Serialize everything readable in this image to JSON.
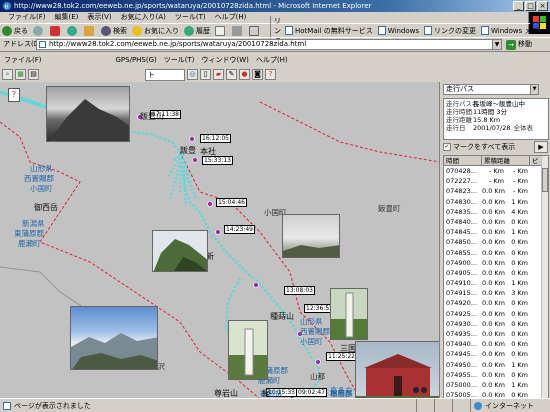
{
  "browser": {
    "title": "http://www28.tok2.com/eeweb.ne.jp/sports/wataruya/20010728zida.html - Microsoft Internet Explorer",
    "menu": [
      "ファイル(F)",
      "編集(E)",
      "表示(V)",
      "お気に入り(A)",
      "ツール(T)",
      "ヘルプ(H)"
    ],
    "toolbar": {
      "back": "戻る",
      "search": "検索",
      "favorites": "お気に入り",
      "history": "履歴",
      "links_label": "リンク"
    },
    "links": [
      "HotMail の無料サービス",
      "Windows",
      "リンクの変更",
      "Windows メディア"
    ],
    "address_label": "アドレス(D)",
    "address": "http://www28.tok2.com/eeweb.ne.jp/sports/wataruya/20010728zida.html",
    "go_label": "移動",
    "status": "ページが表示されました",
    "zone": "インターネット"
  },
  "app": {
    "menu": [
      "ファイル(F)",
      "GPS/PHS(G)",
      "ツール(T)",
      "ウィンドウ(W)",
      "ヘルプ(H)"
    ],
    "select_value": "ト"
  },
  "map": {
    "places": [
      {
        "text": "飯豊山",
        "style": "black"
      },
      {
        "text": "飯豊",
        "style": "black"
      },
      {
        "text": "本社",
        "style": "black"
      },
      {
        "text": "山形県",
        "style": "blue"
      },
      {
        "text": "西置賜郡",
        "style": "blue"
      },
      {
        "text": "小国町",
        "style": "blue"
      },
      {
        "text": "御西岳",
        "style": "black"
      },
      {
        "text": "新潟県",
        "style": "blue"
      },
      {
        "text": "東蒲原郡",
        "style": "blue"
      },
      {
        "text": "鹿瀬町",
        "style": "blue"
      },
      {
        "text": "小国町",
        "style": "grey"
      },
      {
        "text": "飯豊町",
        "style": "grey"
      },
      {
        "text": "種蒔山",
        "style": "black"
      },
      {
        "text": "山形県",
        "style": "blue"
      },
      {
        "text": "西置賜郡",
        "style": "blue"
      },
      {
        "text": "小国町",
        "style": "blue"
      },
      {
        "text": "三国岳",
        "style": "black"
      },
      {
        "text": "東蒲原郡",
        "style": "blue"
      },
      {
        "text": "鹿瀬町",
        "style": "blue"
      },
      {
        "text": "追沢",
        "style": "grey"
      },
      {
        "text": "山都",
        "style": "grey"
      },
      {
        "text": "福島県",
        "style": "blue"
      },
      {
        "text": "喜多方",
        "style": "blue"
      },
      {
        "text": "福島県",
        "style": "blue"
      },
      {
        "text": "耶麻郡",
        "style": "blue"
      },
      {
        "text": "新",
        "style": "black"
      },
      {
        "text": "尊岩山",
        "style": "black"
      },
      {
        "text": "緑",
        "style": "black"
      }
    ],
    "time_labels": [
      "17:11:38",
      "16:12:05",
      "15:33:13",
      "15:04:46",
      "14:23:49",
      "13:08:03",
      "12:36:52",
      "11:25:22",
      "10:15:33",
      "09:02:47"
    ]
  },
  "sidebar": {
    "dropdown": "走行パス",
    "track": [
      {
        "key": "走行パス名",
        "value": "長坂峰～飯豊山中"
      },
      {
        "key": "走行時間",
        "value": "11時間 3分"
      },
      {
        "key": "走行距離",
        "value": "15.8 Km"
      },
      {
        "key": "走行日",
        "value": "2001/07/28"
      }
    ],
    "show_all_label": "全体表",
    "mark_label": "マークをすべて表示",
    "columns": [
      "時間",
      "累積距離",
      "ピ"
    ],
    "rows": [
      {
        "time": "070428...",
        "dist": "- Km",
        "alt": "- Km",
        "p": "-"
      },
      {
        "time": "072227...",
        "dist": "- Km",
        "alt": "- Km",
        "p": "-"
      },
      {
        "time": "074823...",
        "dist": "0.0 Km",
        "alt": "- Km",
        "p": "-"
      },
      {
        "time": "074830...",
        "dist": "0.0 Km",
        "alt": "1 Km",
        "p": "-"
      },
      {
        "time": "074835...",
        "dist": "0.0 Km",
        "alt": "4 Km",
        "p": "-"
      },
      {
        "time": "074840...",
        "dist": "0.0 Km",
        "alt": "0 Km",
        "p": "-"
      },
      {
        "time": "074845...",
        "dist": "0.0 Km",
        "alt": "1 Km",
        "p": "-"
      },
      {
        "time": "074850...",
        "dist": "0.0 Km",
        "alt": "0 Km",
        "p": "-"
      },
      {
        "time": "074855...",
        "dist": "0.0 Km",
        "alt": "0 Km",
        "p": "-"
      },
      {
        "time": "074900...",
        "dist": "0.0 Km",
        "alt": "0 Km",
        "p": "-"
      },
      {
        "time": "074905...",
        "dist": "0.0 Km",
        "alt": "0 Km",
        "p": "-"
      },
      {
        "time": "074910...",
        "dist": "0.0 Km",
        "alt": "1 Km",
        "p": "-"
      },
      {
        "time": "074915...",
        "dist": "0.0 Km",
        "alt": "3 Km",
        "p": "-"
      },
      {
        "time": "074920...",
        "dist": "0.0 Km",
        "alt": "0 Km",
        "p": "-"
      },
      {
        "time": "074925...",
        "dist": "0.0 Km",
        "alt": "0 Km",
        "p": "-"
      },
      {
        "time": "074930...",
        "dist": "0.0 Km",
        "alt": "0 Km",
        "p": "-"
      },
      {
        "time": "074935...",
        "dist": "0.0 Km",
        "alt": "0 Km",
        "p": "-"
      },
      {
        "time": "074940...",
        "dist": "0.0 Km",
        "alt": "0 Km",
        "p": "-"
      },
      {
        "time": "074945...",
        "dist": "0.0 Km",
        "alt": "0 Km",
        "p": "-"
      },
      {
        "time": "074950...",
        "dist": "0.0 Km",
        "alt": "1 Km",
        "p": "-"
      },
      {
        "time": "074955...",
        "dist": "0.0 Km",
        "alt": "0 Km",
        "p": "-"
      },
      {
        "time": "075000...",
        "dist": "0.0 Km",
        "alt": "1 Km",
        "p": "-"
      },
      {
        "time": "075005...",
        "dist": "0.0 Km",
        "alt": "0 Km",
        "p": "-"
      },
      {
        "time": "075010...",
        "dist": "0.0 Km",
        "alt": "2 Km",
        "p": "-"
      }
    ]
  }
}
